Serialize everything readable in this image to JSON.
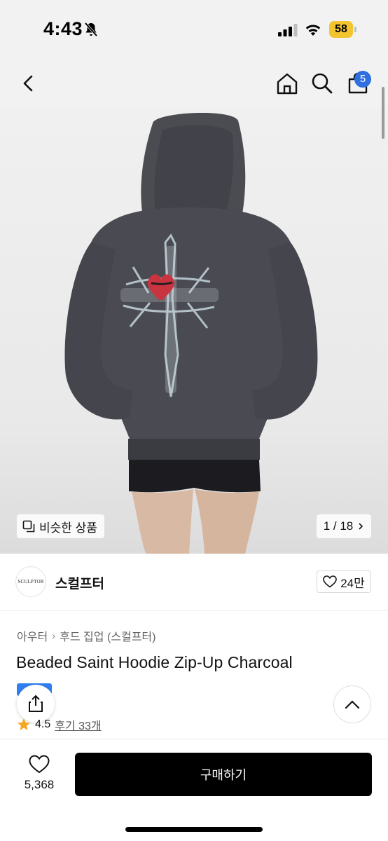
{
  "status_bar": {
    "time": "4:43",
    "battery": "58",
    "battery_color": "#f4c430"
  },
  "top_nav": {
    "back_icon": "chevron-left-icon",
    "home_icon": "home-icon",
    "search_icon": "search-icon",
    "bag_icon": "shopping-bag-icon",
    "bag_count": "5",
    "badge_color": "#2f6fe0"
  },
  "gallery": {
    "similar_label": "비슷한 상품",
    "page": "1 / 18"
  },
  "brand": {
    "logo_text": "SCULPTOR",
    "name": "스컬프터",
    "like_count": "24만"
  },
  "product": {
    "category_1": "아우터",
    "category_2": "후드 집업 (스컬프터)",
    "title": "Beaded Saint Hoodie Zip-Up Charcoal",
    "rating": "4.5",
    "review_label": "후기 33개"
  },
  "bottom_bar": {
    "wish_count": "5,368",
    "buy_label": "구매하기"
  }
}
